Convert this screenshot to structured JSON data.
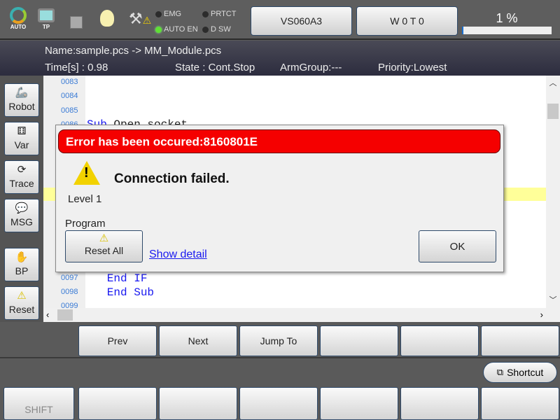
{
  "topbar": {
    "mode": "AUTO",
    "pendant": "TP",
    "leds": {
      "emg": "EMG",
      "auto_en": "AUTO EN",
      "prtct": "PRTCT",
      "dsw": "D SW"
    },
    "robot_button": "VS060A3",
    "work_tool_button": "W 0 T 0",
    "speed": "1 %",
    "speed_value_percent": 1
  },
  "info": {
    "name": "Name:sample.pcs -> MM_Module.pcs",
    "time": "Time[s] : 0.98",
    "state": "State : Cont.Stop",
    "armgroup": "ArmGroup:---",
    "priority": "Priority:Lowest"
  },
  "sidebar": {
    "robot": "Robot",
    "var": "Var",
    "trace": "Trace",
    "msg": "MSG",
    "bp": "BP",
    "reset": "Reset"
  },
  "editor": {
    "lines": [
      {
        "num": "0083",
        "code": ""
      },
      {
        "num": "0084",
        "code": ""
      },
      {
        "num": "0085",
        "code": ""
      },
      {
        "num": "0086",
        "code": "Sub Open_socket"
      },
      {
        "num": "0097",
        "code": "   End IF"
      },
      {
        "num": "0098",
        "code": "   End Sub"
      },
      {
        "num": "0099",
        "code": ""
      }
    ]
  },
  "dialog": {
    "title": "Error has been occured:8160801E",
    "message": "Connection failed.",
    "level": "Level 1",
    "source": "Program",
    "reset_all": "Reset All",
    "show_detail": "Show detail",
    "ok": "OK"
  },
  "fn": {
    "prev": "Prev",
    "next": "Next",
    "jump": "Jump To"
  },
  "shortcut": "Shortcut",
  "shift": "SHIFT",
  "colors": {
    "error": "#f50000",
    "link": "#1a1af0",
    "highlight": "#ffff99"
  }
}
